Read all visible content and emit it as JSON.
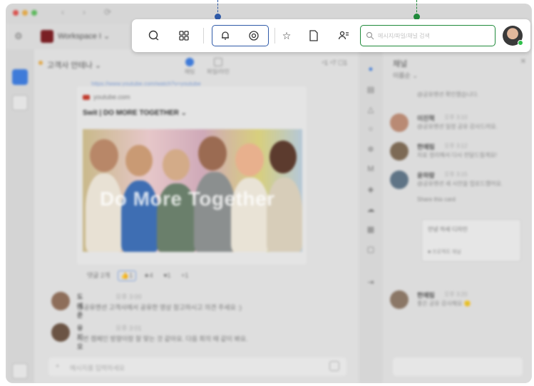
{
  "titlebar": {
    "nav": [
      "‹",
      "›",
      "⟳"
    ]
  },
  "workspace": {
    "name": "Workspace I ⌄"
  },
  "channel": {
    "title": "고객사 안테나 ⌄",
    "tab1": "채팅",
    "tab2": "파일/라인",
    "counts": "⁴1  ⁴7  ☐1"
  },
  "link_card": {
    "url": "https://www.youtube.com/watch?v=youtube",
    "source": "youtube.com",
    "title": "Swit | DO MORE TOGETHER ⌄",
    "image_text": "Do More Together"
  },
  "reactions": {
    "reply": "댓글 2개",
    "r1": "👍1",
    "r2": "★4",
    "r3": "♥1",
    "r4": "+1"
  },
  "comments": [
    {
      "name": "도예준",
      "time": "오후 3:00",
      "text": "@공유멘션 고객사에서 공유한 영상 참고하시고 의견 주세요 :)"
    },
    {
      "name": "유지오",
      "time": "오후 3:01",
      "text": "이번 캠페인 방향이랑 잘 맞는 것 같아요. 다음 회의 때 같이 봐요."
    }
  ],
  "composer": {
    "placeholder": "메시지를 입력하세요"
  },
  "thread": {
    "title": "채널",
    "subtitle": "이름순 ⌄",
    "items": [
      {
        "name": "",
        "time": "",
        "text": "@공유멘션 확인했습니다."
      },
      {
        "name": "이진혁",
        "time": "오후 3:10",
        "text": "@공유멘션 일정 공유 감사드려요."
      },
      {
        "name": "한예림",
        "time": "오후 3:12",
        "text": "자료 정리해서 다시 전달드릴게요!"
      },
      {
        "name": "윤하람",
        "time": "오후 3:15",
        "text": "@공유멘션 새 시안을 업로드했어요."
      },
      {
        "name": "",
        "time": "",
        "text": "Share this card"
      },
      {
        "name": "한예림",
        "time": "오후 3:20",
        "text": "좋은 공유 감사해요 🙂"
      }
    ],
    "shared_card": "안녕 하세 디자인",
    "shared_meta": "■ 프로젝트 채널"
  },
  "toolbar": {
    "search_placeholder": "메시지/파일/채널 검색",
    "icons": [
      "chat-icon",
      "apps-icon",
      "bell-icon",
      "mention-icon",
      "star-icon",
      "file-icon",
      "team-icon"
    ]
  },
  "colors": {
    "group_outline": "#2f5aa8",
    "search_outline": "#1f8a3a",
    "online": "#2fbf4a"
  }
}
